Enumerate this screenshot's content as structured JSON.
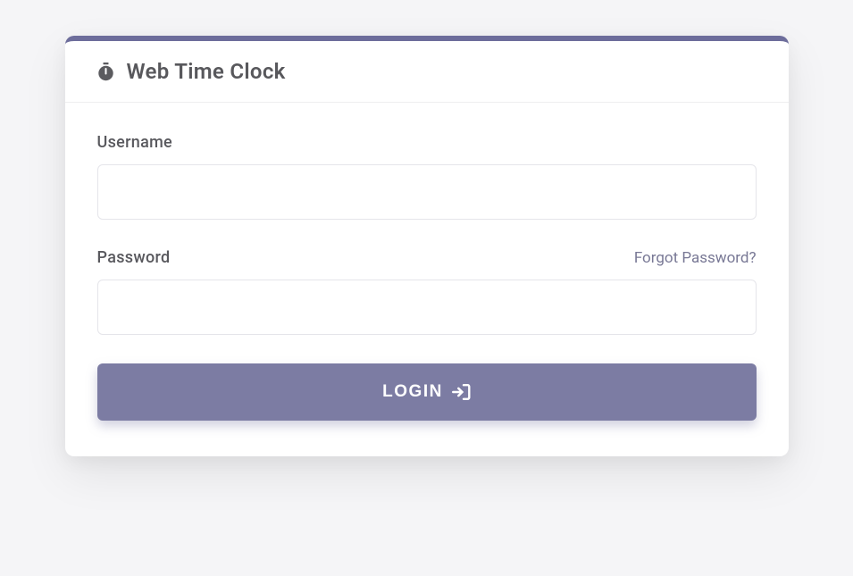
{
  "header": {
    "title": "Web Time Clock"
  },
  "form": {
    "username": {
      "label": "Username",
      "value": ""
    },
    "password": {
      "label": "Password",
      "value": ""
    },
    "forgot_link": "Forgot Password?",
    "login_button": "LOGIN"
  },
  "colors": {
    "accent": "#7c7ca3",
    "accent_border": "#6d6d9b"
  }
}
